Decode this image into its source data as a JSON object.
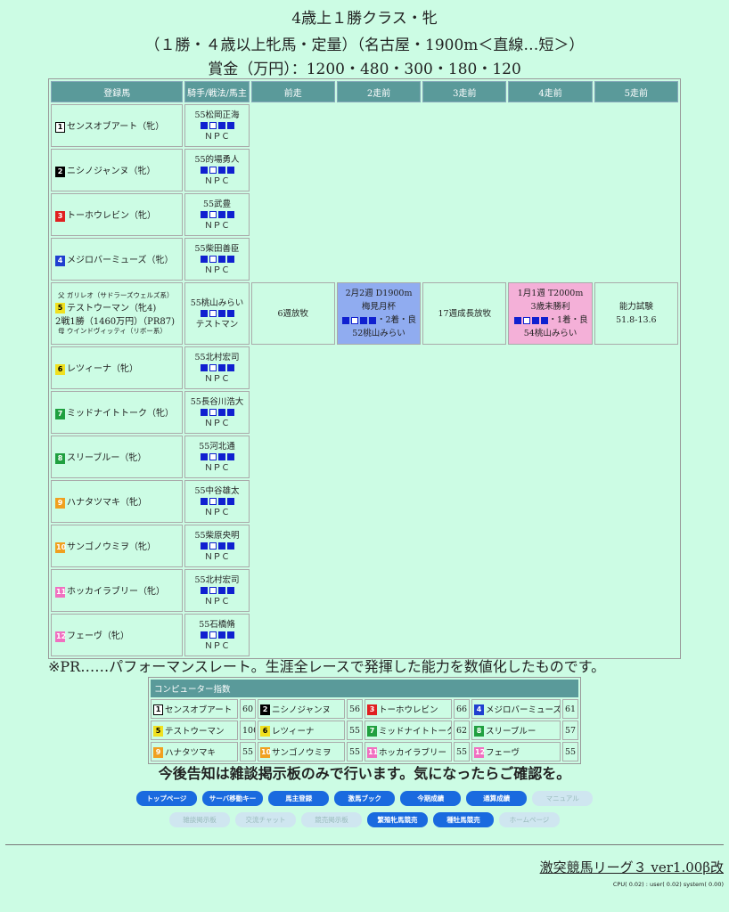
{
  "header": {
    "line1": "4歳上１勝クラス・牝",
    "line2": "（１勝・４歳以上牝馬・定量）（名古屋・1900m＜直線…短＞）",
    "line3": "賞金（万円）：1200・480・300・180・120"
  },
  "table": {
    "headers": [
      "登録馬",
      "騎手/戦法/馬主",
      "前走",
      "2走前",
      "3走前",
      "4走前",
      "5走前"
    ],
    "horses": [
      {
        "num": "1",
        "num_color": "#ffffff",
        "num_text": "#000000",
        "name": "センスオブアート（牝）",
        "jockey": "55松岡正海",
        "owner": "ＮＰＣ"
      },
      {
        "num": "2",
        "num_color": "#000000",
        "num_text": "#ffffff",
        "name": "ニシノジャンヌ（牝）",
        "jockey": "55的場勇人",
        "owner": "ＮＰＣ"
      },
      {
        "num": "3",
        "num_color": "#e02020",
        "num_text": "#ffffff",
        "name": "トーホウレビン（牝）",
        "jockey": "55武豊",
        "owner": "ＮＰＣ"
      },
      {
        "num": "4",
        "num_color": "#2040d0",
        "num_text": "#ffffff",
        "name": "メジロバーミューズ（牝）",
        "jockey": "55柴田善臣",
        "owner": "ＮＰＣ"
      },
      {
        "num": "6",
        "num_color": "#f0e020",
        "num_text": "#000000",
        "name": "レツィーナ（牝）",
        "jockey": "55北村宏司",
        "owner": "ＮＰＣ"
      },
      {
        "num": "7",
        "num_color": "#20a040",
        "num_text": "#ffffff",
        "name": "ミッドナイトトーク（牝）",
        "jockey": "55長谷川浩大",
        "owner": "ＮＰＣ"
      },
      {
        "num": "8",
        "num_color": "#20a040",
        "num_text": "#ffffff",
        "name": "スリーブルー（牝）",
        "jockey": "55河北通",
        "owner": "ＮＰＣ"
      },
      {
        "num": "9",
        "num_color": "#f0a020",
        "num_text": "#ffffff",
        "name": "ハナタツマキ（牝）",
        "jockey": "55中谷雄太",
        "owner": "ＮＰＣ"
      },
      {
        "num": "10",
        "num_color": "#f0a020",
        "num_text": "#ffffff",
        "name": "サンゴノウミヲ（牝）",
        "jockey": "55柴原央明",
        "owner": "ＮＰＣ"
      },
      {
        "num": "11",
        "num_color": "#f070c0",
        "num_text": "#ffffff",
        "name": "ホッカイラブリー（牝）",
        "jockey": "55北村宏司",
        "owner": "ＮＰＣ"
      },
      {
        "num": "12",
        "num_color": "#f070c0",
        "num_text": "#ffffff",
        "name": "フェーヴ（牝）",
        "jockey": "55石橋脩",
        "owner": "ＮＰＣ"
      }
    ],
    "featured": {
      "sire": "父 ガリレオ（サドラーズウェルズ系）",
      "num": "5",
      "name": "テストウーマン（牝4)",
      "record": "2戦1勝（1460万円）（PR87)",
      "dam": "母 ウインドヴィッティ（リボー系）",
      "jockey": "55桃山みらい",
      "owner": "テストマン",
      "prev1": "6週放牧",
      "prev2": {
        "l1": "2月2週 D1900m",
        "l2": "梅見月杯",
        "l3": "・2着・良",
        "l4": "52桃山みらい"
      },
      "prev3": "17週成長放牧",
      "prev4": {
        "l1": "1月1週 T2000m",
        "l2": "3歳未勝利",
        "l3": "・1着・良",
        "l4": "54桃山みらい"
      },
      "prev5": {
        "l1": "能力試験",
        "l2": "51.8-13.6"
      }
    }
  },
  "note": "※PR……パフォーマンスレート。生涯全レースで発揮した能力を数値化したものです。",
  "computer_index": {
    "title": "コンピューター指数",
    "rows": [
      [
        {
          "num": "1",
          "name": "センスオブアート",
          "v": "60"
        },
        {
          "num": "2",
          "name": "ニシノジャンヌ",
          "v": "56"
        },
        {
          "num": "3",
          "name": "トーホウレビン",
          "v": "66"
        },
        {
          "num": "4",
          "name": "メジロバーミューズ",
          "v": "61"
        }
      ],
      [
        {
          "num": "5",
          "name": "テストウーマン",
          "v": "100"
        },
        {
          "num": "6",
          "name": "レツィーナ",
          "v": "55"
        },
        {
          "num": "7",
          "name": "ミッドナイトトーク",
          "v": "62"
        },
        {
          "num": "8",
          "name": "スリーブルー",
          "v": "57"
        }
      ],
      [
        {
          "num": "9",
          "name": "ハナタツマキ",
          "v": "55"
        },
        {
          "num": "10",
          "name": "サンゴノウミヲ",
          "v": "55"
        },
        {
          "num": "11",
          "name": "ホッカイラブリー",
          "v": "55"
        },
        {
          "num": "12",
          "name": "フェーヴ",
          "v": "55"
        }
      ]
    ]
  },
  "announce": "今後告知は雑談掲示板のみで行います。気になったらご確認を。",
  "nav1": [
    "トップページ",
    "サーバ移動キー",
    "馬主登録",
    "激馬ブック",
    "今期成績",
    "通算成績",
    "マニュアル"
  ],
  "nav2": [
    "雑談掲示板",
    "交流チャット",
    "競売掲示板",
    "繁殖牝馬競売",
    "種牡馬競売",
    "ホームページ"
  ],
  "footer": {
    "title": "激突競馬リーグ３ ver1.00β改",
    "cpu": "CPU( 0.02) : user( 0.02) system( 0.00)"
  }
}
